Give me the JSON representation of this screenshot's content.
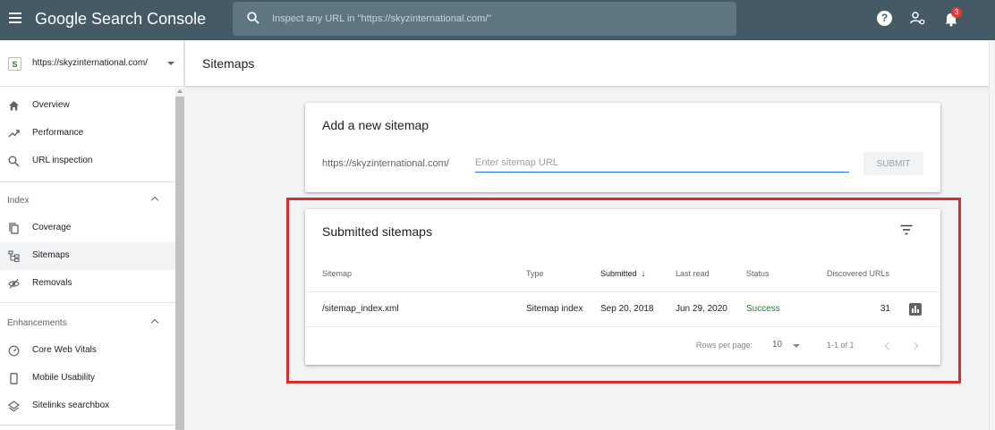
{
  "topbar": {
    "brand": "Google Search Console",
    "search_placeholder": "Inspect any URL in \"https://skyzinternational.com/\"",
    "notification_count": "3"
  },
  "sidebar": {
    "property_url": "https://skyzinternational.com/",
    "main_items": [
      {
        "label": "Overview",
        "icon": "home-icon"
      },
      {
        "label": "Performance",
        "icon": "trending-up-icon"
      },
      {
        "label": "URL inspection",
        "icon": "search-icon"
      }
    ],
    "index_section": {
      "label": "Index",
      "items": [
        {
          "label": "Coverage",
          "icon": "copy-icon"
        },
        {
          "label": "Sitemaps",
          "icon": "sitemap-icon",
          "active": true
        },
        {
          "label": "Removals",
          "icon": "eye-off-icon"
        }
      ]
    },
    "enhancements_section": {
      "label": "Enhancements",
      "items": [
        {
          "label": "Core Web Vitals",
          "icon": "gauge-icon"
        },
        {
          "label": "Mobile Usability",
          "icon": "phone-icon"
        },
        {
          "label": "Sitelinks searchbox",
          "icon": "layers-icon"
        }
      ]
    }
  },
  "page": {
    "title": "Sitemaps"
  },
  "add_sitemap": {
    "title": "Add a new sitemap",
    "prefix": "https://skyzinternational.com/",
    "placeholder": "Enter sitemap URL",
    "submit_label": "SUBMIT"
  },
  "submitted": {
    "title": "Submitted sitemaps",
    "columns": {
      "sitemap": "Sitemap",
      "type": "Type",
      "submitted": "Submitted",
      "last_read": "Last read",
      "status": "Status",
      "discovered": "Discovered URLs"
    },
    "rows": [
      {
        "sitemap": "/sitemap_index.xml",
        "type": "Sitemap index",
        "submitted": "Sep 20, 2018",
        "last_read": "Jun 29, 2020",
        "status": "Success",
        "discovered": "31"
      }
    ],
    "footer": {
      "rows_per_page_label": "Rows per page:",
      "rows_per_page_value": "10",
      "range": "1-1 of 1"
    }
  },
  "colors": {
    "topbar": "#455a64",
    "success": "#188038",
    "highlight": "#d32f2f",
    "accent": "#1a73e8"
  }
}
